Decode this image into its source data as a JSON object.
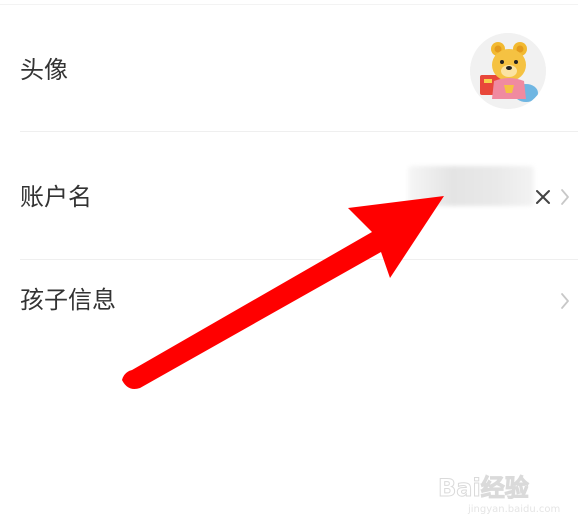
{
  "settings": {
    "rows": [
      {
        "label": "头像"
      },
      {
        "label": "账户名"
      },
      {
        "label": "孩子信息"
      }
    ]
  },
  "watermark": {
    "brand": "Bai经验",
    "url": "jingyan.baidu.com"
  },
  "colors": {
    "arrow": "#ff0000",
    "divider": "#efefef",
    "label": "#333333",
    "avatar_bear": "#f5c242"
  }
}
